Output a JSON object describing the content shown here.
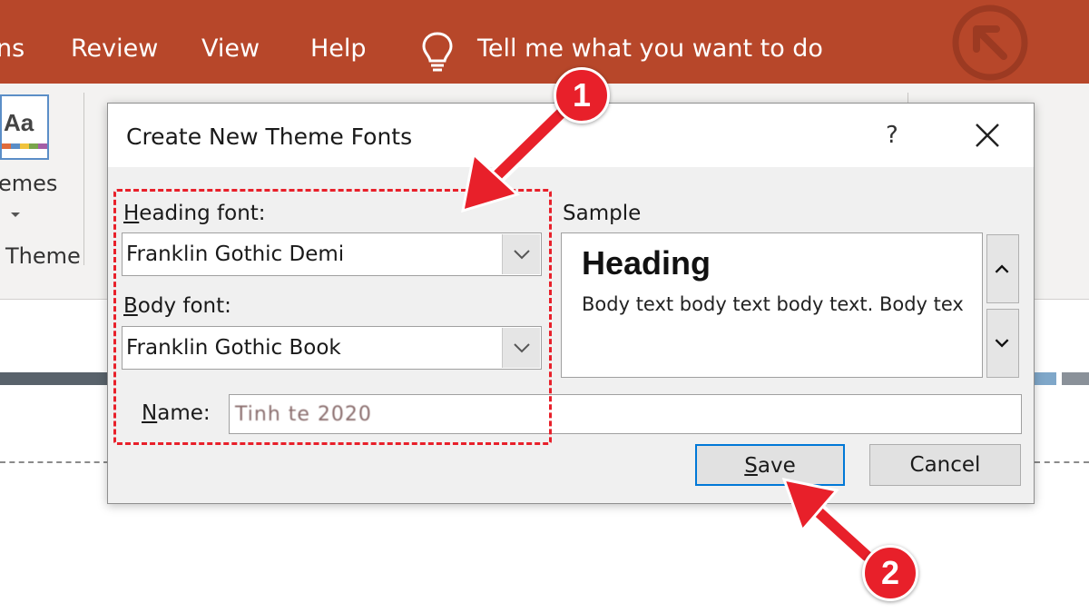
{
  "ribbon": {
    "tabs": [
      {
        "label": "ns"
      },
      {
        "label": "Review"
      },
      {
        "label": "View"
      },
      {
        "label": "Help"
      }
    ],
    "tell_me": "Tell me what you want to do",
    "themes_label": "emes",
    "themes_group_label": "Theme",
    "accent_color": "#b7472a"
  },
  "dialog": {
    "title": "Create New Theme Fonts",
    "help": "?",
    "heading_font_label": "Heading font:",
    "heading_font_label_hotkey": "H",
    "heading_font_value": "Franklin Gothic Demi",
    "body_font_label": "Body font:",
    "body_font_label_hotkey": "B",
    "body_font_value": "Franklin Gothic Book",
    "sample_label": "Sample",
    "sample_heading": "Heading",
    "sample_body": "Body text body text body text. Body text body text.",
    "name_label": "Name:",
    "name_value": "Tinh te 2020",
    "save_label": "Save",
    "cancel_label": "Cancel"
  },
  "annotations": {
    "step1": "1",
    "step2": "2",
    "color": "#e8202a"
  }
}
